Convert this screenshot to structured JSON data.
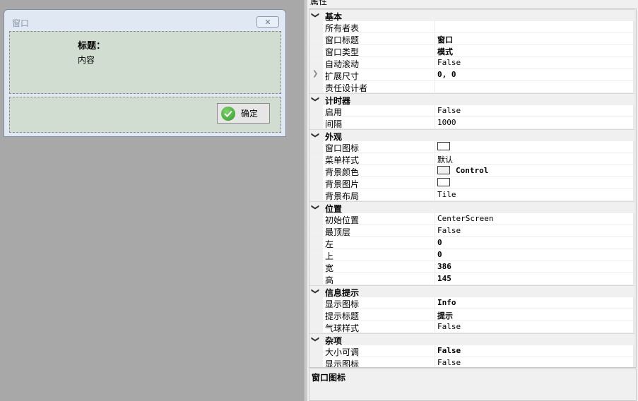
{
  "dialog": {
    "title": "窗口",
    "close_glyph": "✕",
    "message_title": "标题：",
    "message_content": "内容",
    "ok_label": "确定"
  },
  "property_panel": {
    "header": "属性",
    "description_title": "窗口图标"
  },
  "categories": [
    {
      "label": "基本",
      "expanded": true,
      "props": [
        {
          "name": "所有者表",
          "value": ""
        },
        {
          "name": "窗口标题",
          "value": "窗口",
          "bold": true
        },
        {
          "name": "窗口类型",
          "value": "模式",
          "bold": true
        },
        {
          "name": "自动滚动",
          "value": "False"
        },
        {
          "name": "扩展尺寸",
          "value": "0, 0",
          "bold": true,
          "expandable": true
        },
        {
          "name": "责任设计者",
          "value": ""
        }
      ]
    },
    {
      "label": "计时器",
      "expanded": true,
      "props": [
        {
          "name": "启用",
          "value": "False"
        },
        {
          "name": "间隔",
          "value": "1000"
        }
      ]
    },
    {
      "label": "外观",
      "expanded": true,
      "props": [
        {
          "name": "窗口图标",
          "value": "",
          "swatch": "#ffffff"
        },
        {
          "name": "菜单样式",
          "value": "默认"
        },
        {
          "name": "背景颜色",
          "value": "Control",
          "bold": true,
          "swatch": "#f0f0f0"
        },
        {
          "name": "背景图片",
          "value": "",
          "swatch": "#ffffff"
        },
        {
          "name": "背景布局",
          "value": "Tile"
        }
      ]
    },
    {
      "label": "位置",
      "expanded": true,
      "props": [
        {
          "name": "初始位置",
          "value": "CenterScreen"
        },
        {
          "name": "最顶层",
          "value": "False"
        },
        {
          "name": "左",
          "value": "0",
          "bold": true
        },
        {
          "name": "上",
          "value": "0",
          "bold": true
        },
        {
          "name": "宽",
          "value": "386",
          "bold": true
        },
        {
          "name": "高",
          "value": "145",
          "bold": true
        }
      ]
    },
    {
      "label": "信息提示",
      "expanded": true,
      "props": [
        {
          "name": "显示图标",
          "value": "Info",
          "bold": true
        },
        {
          "name": "提示标题",
          "value": "提示",
          "bold": true
        },
        {
          "name": "气球样式",
          "value": "False"
        }
      ]
    },
    {
      "label": "杂项",
      "expanded": true,
      "props": [
        {
          "name": "大小可调",
          "value": "False",
          "bold": true
        },
        {
          "name": "显示图标",
          "value": "False"
        }
      ]
    }
  ]
}
